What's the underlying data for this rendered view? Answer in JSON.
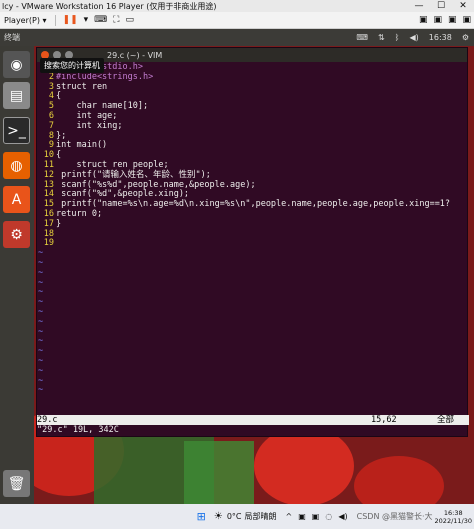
{
  "vm": {
    "title": "lcy - VMware Workstation 16 Player (仅用于非商业用途)",
    "player_menu": "Player(P) ▾",
    "win_min": "—",
    "win_max": "☐",
    "win_close": "✕"
  },
  "ubuntu": {
    "app_name": "终端",
    "time": "16:38",
    "tooltip": "搜索您的计算机"
  },
  "terminal": {
    "title": "29.c (~) - VIM",
    "lines": [
      {
        "n": "1",
        "text": "#include<stdio.h>"
      },
      {
        "n": "2",
        "text": "#include<strings.h>"
      },
      {
        "n": "3",
        "text": "struct ren"
      },
      {
        "n": "4",
        "text": "{"
      },
      {
        "n": "5",
        "text": "    char name[10];"
      },
      {
        "n": "6",
        "text": "    int age;"
      },
      {
        "n": "7",
        "text": "    int xing;"
      },
      {
        "n": "8",
        "text": "};"
      },
      {
        "n": "9",
        "text": "int main()"
      },
      {
        "n": "10",
        "text": "{"
      },
      {
        "n": "11",
        "text": "    struct ren people;"
      },
      {
        "n": "12",
        "text": " printf(\"请输入姓名、年龄、性别\");"
      },
      {
        "n": "13",
        "text": " scanf(\"%s%d\",people.name,&people.age);"
      },
      {
        "n": "14",
        "text": " scanf(\"%d\",&people.xing);"
      },
      {
        "n": "15",
        "text": " printf(\"name=%s\\n.age=%d\\n.xing=%s\\n\",people.name,people.age,people.xing==1?"
      },
      {
        "n": "16",
        "text": "return 0;"
      },
      {
        "n": "17",
        "text": "}"
      },
      {
        "n": "18",
        "text": ""
      },
      {
        "n": "19",
        "text": ""
      }
    ],
    "tilde": "~",
    "tilde_count": 15,
    "status_file": "29.c",
    "status_pos": "15,62",
    "status_all": "全部",
    "message": "\"29.c\" 19L, 342C"
  },
  "taskbar": {
    "weather_temp": "0°C",
    "weather_text": "局部晴朗",
    "clock_time": "16:38",
    "clock_date": "2022/11/30",
    "watermark": "CSDN @黑猫警长·大"
  }
}
